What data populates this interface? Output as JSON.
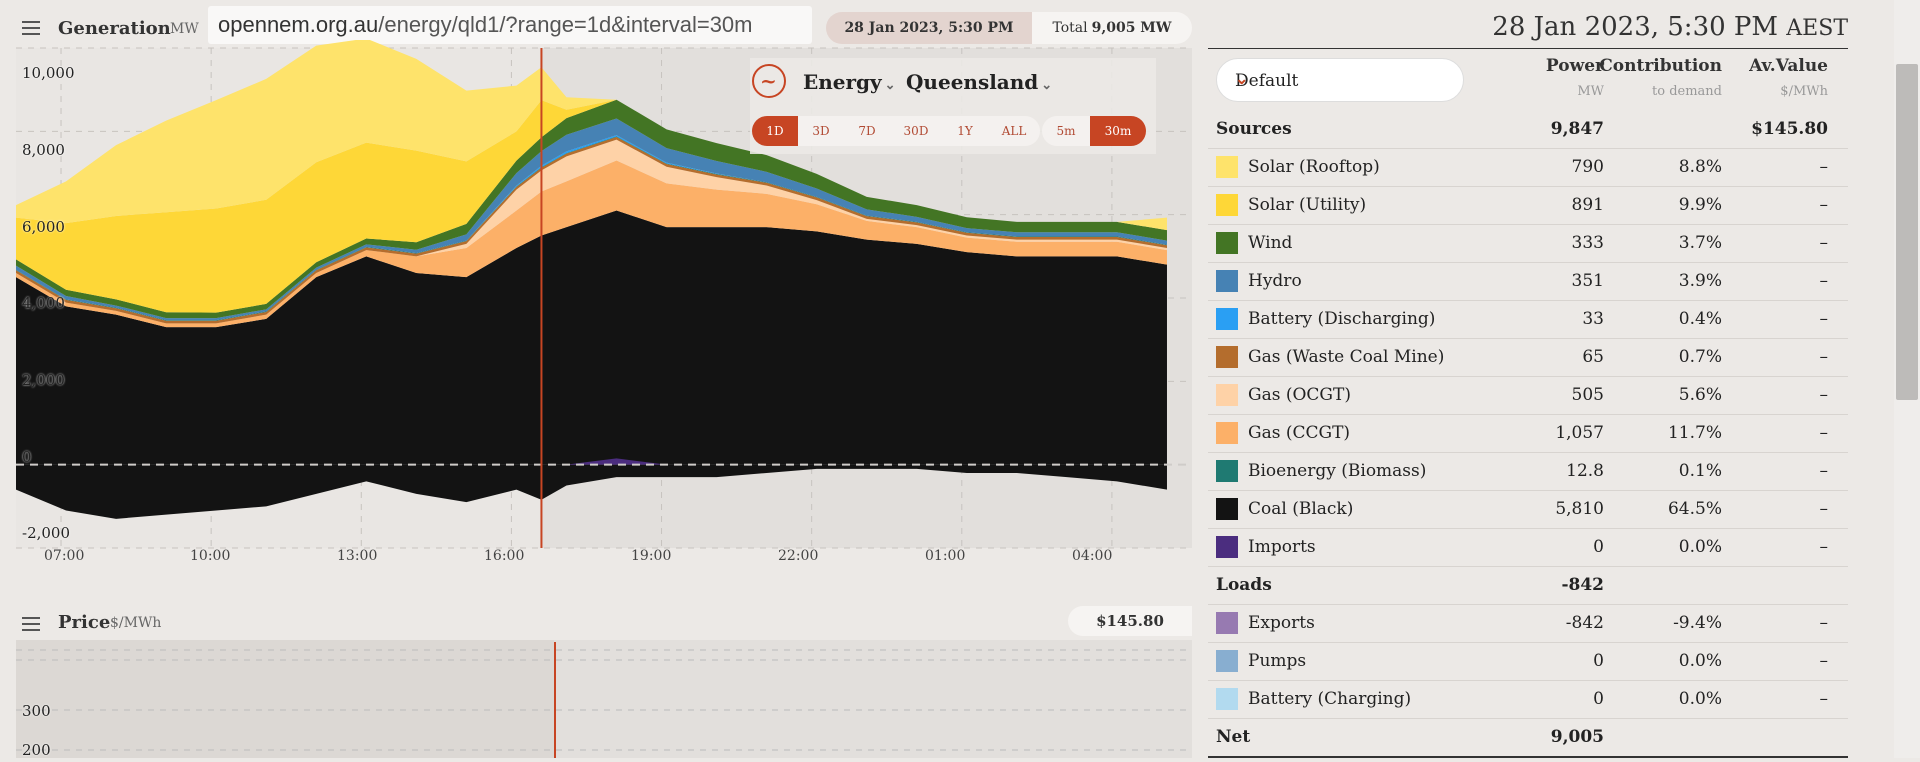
{
  "generation": {
    "title": "Generation",
    "unit": "MW"
  },
  "url": {
    "host": "opennem.org.au",
    "path": "/energy/qld1/?range=1d&interval=30m"
  },
  "date_pill": "28 Jan 2023, 5:30 PM",
  "total": {
    "label": "Total",
    "value": "9,005 MW"
  },
  "controls": {
    "energy_label": "Energy",
    "region_label": "Queensland",
    "ranges": [
      "1D",
      "3D",
      "7D",
      "30D",
      "1Y",
      "ALL"
    ],
    "active_range": "1D",
    "intervals": [
      "5m",
      "30m"
    ],
    "active_interval": "30m"
  },
  "y_ticks": [
    "10,000",
    "8,000",
    "6,000",
    "4,000",
    "2,000",
    "0",
    "-2,000"
  ],
  "x_ticks": [
    "07:00",
    "10:00",
    "13:00",
    "16:00",
    "19:00",
    "22:00",
    "01:00",
    "04:00"
  ],
  "price": {
    "title": "Price",
    "unit": "$/MWh",
    "value": "$145.80",
    "y_ticks": [
      "300",
      "200"
    ]
  },
  "chart_data": {
    "type": "area",
    "stacked": true,
    "ylim": [
      -2000,
      10000
    ],
    "x": [
      "07:00",
      "08:00",
      "09:00",
      "10:00",
      "11:00",
      "12:00",
      "13:00",
      "14:00",
      "15:00",
      "16:00",
      "17:00",
      "17:30",
      "18:00",
      "19:00",
      "20:00",
      "21:00",
      "22:00",
      "23:00",
      "00:00",
      "01:00",
      "02:00",
      "03:00",
      "04:00",
      "05:00",
      "06:00"
    ],
    "series": [
      {
        "name": "Coal (Black)",
        "color": "#131313",
        "values": [
          4500,
          3800,
          3600,
          3300,
          3300,
          3500,
          4500,
          5000,
          4600,
          4500,
          5200,
          5500,
          5700,
          6100,
          5700,
          5700,
          5700,
          5600,
          5400,
          5300,
          5100,
          5000,
          5000,
          5000,
          4800
        ]
      },
      {
        "name": "Gas (CCGT)",
        "color": "#fcb068",
        "values": [
          100,
          90,
          90,
          90,
          90,
          100,
          100,
          150,
          400,
          700,
          900,
          1057,
          1100,
          1200,
          1050,
          900,
          800,
          650,
          450,
          400,
          350,
          350,
          350,
          350,
          350
        ]
      },
      {
        "name": "Gas (OCGT)",
        "color": "#fed2a7",
        "values": [
          0,
          0,
          0,
          0,
          0,
          0,
          0,
          0,
          0,
          100,
          500,
          505,
          600,
          500,
          400,
          300,
          200,
          100,
          50,
          50,
          50,
          50,
          50,
          50,
          50
        ]
      },
      {
        "name": "Gas (Waste Coal Mine)",
        "color": "#b46d2d",
        "values": [
          65,
          65,
          65,
          65,
          65,
          65,
          65,
          65,
          65,
          65,
          65,
          65,
          65,
          65,
          65,
          65,
          65,
          65,
          65,
          65,
          65,
          65,
          65,
          65,
          65
        ]
      },
      {
        "name": "Bioenergy (Biomass)",
        "color": "#1f7a72",
        "values": [
          13,
          13,
          13,
          13,
          13,
          13,
          13,
          13,
          13,
          13,
          13,
          12.8,
          13,
          13,
          13,
          13,
          13,
          13,
          13,
          13,
          13,
          13,
          13,
          13,
          13
        ]
      },
      {
        "name": "Battery (Discharging)",
        "color": "#2a9ff3",
        "values": [
          0,
          0,
          0,
          0,
          0,
          0,
          0,
          0,
          0,
          0,
          20,
          33,
          40,
          30,
          20,
          10,
          0,
          0,
          0,
          0,
          0,
          0,
          0,
          0,
          0
        ]
      },
      {
        "name": "Hydro",
        "color": "#4682b4",
        "values": [
          100,
          80,
          50,
          50,
          50,
          50,
          50,
          60,
          80,
          150,
          300,
          351,
          400,
          400,
          350,
          300,
          250,
          200,
          150,
          120,
          100,
          100,
          100,
          100,
          100
        ]
      },
      {
        "name": "Wind",
        "color": "#437524",
        "values": [
          150,
          150,
          150,
          140,
          130,
          130,
          130,
          140,
          180,
          250,
          300,
          333,
          400,
          450,
          450,
          430,
          400,
          350,
          300,
          280,
          260,
          250,
          250,
          250,
          250
        ]
      },
      {
        "name": "Solar (Utility)",
        "color": "#fed737",
        "values": [
          1000,
          1600,
          2000,
          2400,
          2500,
          2500,
          2400,
          2300,
          2200,
          1500,
          700,
          891,
          200,
          0,
          0,
          0,
          0,
          0,
          0,
          0,
          0,
          0,
          0,
          0,
          0
        ]
      },
      {
        "name": "Solar (Rooftop)",
        "color": "#fee36b",
        "values": [
          300,
          1000,
          1700,
          2200,
          2600,
          2900,
          2800,
          2500,
          2200,
          1700,
          1100,
          790,
          300,
          0,
          0,
          0,
          0,
          0,
          0,
          0,
          0,
          0,
          0,
          0,
          300
        ]
      },
      {
        "name": "Exports",
        "color": "#131313",
        "values": [
          -600,
          -1100,
          -1300,
          -1200,
          -1100,
          -1000,
          -700,
          -400,
          -700,
          -900,
          -600,
          -842,
          -500,
          -300,
          -300,
          -300,
          -200,
          -100,
          -100,
          -100,
          -200,
          -200,
          -300,
          -400,
          -600
        ]
      },
      {
        "name": "Imports",
        "color": "#4b2d7f",
        "values": [
          0,
          0,
          0,
          0,
          0,
          0,
          0,
          0,
          0,
          0,
          0,
          0,
          0,
          150,
          0,
          0,
          0,
          0,
          0,
          0,
          0,
          0,
          0,
          0,
          0
        ]
      }
    ],
    "cursor_x": "17:30"
  },
  "table": {
    "date": "28 Jan 2023, 5:30 PM",
    "tz": "AEST",
    "select": "Default",
    "col_power": "Power",
    "col_power_unit": "MW",
    "col_contrib": "Contribution",
    "col_contrib_unit": "to demand",
    "col_av": "Av.Value",
    "col_av_unit": "$/MWh",
    "sources": {
      "label": "Sources",
      "power": "9,847",
      "av": "$145.80"
    },
    "source_rows": [
      {
        "label": "Solar (Rooftop)",
        "color": "#fee36b",
        "power": "790",
        "contrib": "8.8%",
        "av": "–"
      },
      {
        "label": "Solar (Utility)",
        "color": "#fed737",
        "power": "891",
        "contrib": "9.9%",
        "av": "–"
      },
      {
        "label": "Wind",
        "color": "#437524",
        "power": "333",
        "contrib": "3.7%",
        "av": "–"
      },
      {
        "label": "Hydro",
        "color": "#4682b4",
        "power": "351",
        "contrib": "3.9%",
        "av": "–"
      },
      {
        "label": "Battery (Discharging)",
        "color": "#2a9ff3",
        "power": "33",
        "contrib": "0.4%",
        "av": "–"
      },
      {
        "label": "Gas (Waste Coal Mine)",
        "color": "#b46d2d",
        "power": "65",
        "contrib": "0.7%",
        "av": "–"
      },
      {
        "label": "Gas (OCGT)",
        "color": "#fed2a7",
        "power": "505",
        "contrib": "5.6%",
        "av": "–"
      },
      {
        "label": "Gas (CCGT)",
        "color": "#fcb068",
        "power": "1,057",
        "contrib": "11.7%",
        "av": "–"
      },
      {
        "label": "Bioenergy (Biomass)",
        "color": "#1f7a72",
        "power": "12.8",
        "contrib": "0.1%",
        "av": "–"
      },
      {
        "label": "Coal (Black)",
        "color": "#131313",
        "power": "5,810",
        "contrib": "64.5%",
        "av": "–"
      },
      {
        "label": "Imports",
        "color": "#4b2d7f",
        "power": "0",
        "contrib": "0.0%",
        "av": "–"
      }
    ],
    "loads": {
      "label": "Loads",
      "power": "-842"
    },
    "load_rows": [
      {
        "label": "Exports",
        "color": "#977ab1",
        "power": "-842",
        "contrib": "-9.4%",
        "av": "–"
      },
      {
        "label": "Pumps",
        "color": "#88aed0",
        "power": "0",
        "contrib": "0.0%",
        "av": "–"
      },
      {
        "label": "Battery (Charging)",
        "color": "#b2daef",
        "power": "0",
        "contrib": "0.0%",
        "av": "–"
      }
    ],
    "net": {
      "label": "Net",
      "power": "9,005"
    }
  }
}
